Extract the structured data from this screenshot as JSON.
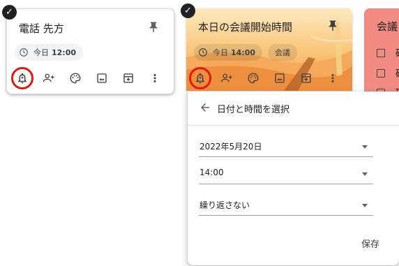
{
  "notes": [
    {
      "title": "電話 先方",
      "reminder": {
        "date": "今日",
        "time": "12:00"
      }
    },
    {
      "title": "本日の会議開始時間",
      "reminder": {
        "date": "今日",
        "time": "14:00"
      },
      "label": "会議"
    },
    {
      "title": "会議",
      "check_items": [
        "確",
        "確",
        "確"
      ]
    }
  ],
  "toolbar_icons": [
    "reminder-bell-icon",
    "collaborator-icon",
    "palette-icon",
    "image-icon",
    "archive-icon",
    "more-vert-icon"
  ],
  "datetime_popup": {
    "title": "日付と時間を選択",
    "date_value": "2022年5月20日",
    "time_value": "14:00",
    "repeat_value": "繰り返さない",
    "save_label": "保存"
  },
  "colors": {
    "highlight_ring": "#e8160c",
    "card3_bg": "#f28b82",
    "card2_bg": "#f5a55a"
  }
}
